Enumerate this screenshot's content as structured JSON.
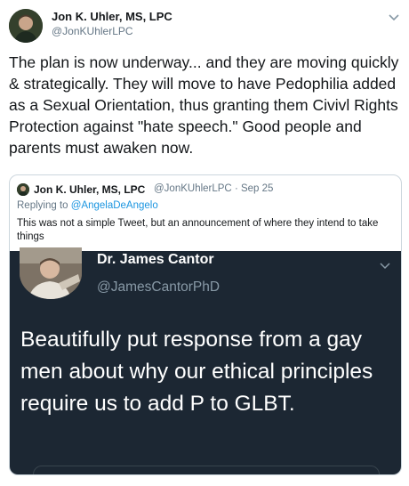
{
  "tweet": {
    "author_name": "Jon K. Uhler, MS, LPC",
    "author_handle": "@JonKUhlerLPC",
    "body": "The plan is now underway... and they are moving quickly & strategically. They will move to have Pedophilia added as a Sexual Orientation, thus granting them Civivl Rights Protection against \"hate speech.\"  Good people and parents must awaken now."
  },
  "quoted_tweet": {
    "author_name": "Jon K. Uhler, MS, LPC",
    "author_handle": "@JonKUhlerLPC",
    "date": "Sep 25",
    "reply_prefix": "Replying to ",
    "reply_to": "@AngelaDeAngelo",
    "body": "This was not a simple Tweet, but an announcement of where they intend to take things"
  },
  "embedded_screenshot": {
    "author_name": "Dr. James Cantor",
    "author_handle": "@JamesCantorPhD",
    "body": "Beautifully put response from a gay men about why our ethical principles require us to add P to GLBT."
  },
  "icons": {
    "menu": "chevron-down-icon"
  },
  "colors": {
    "link": "#1b95e0",
    "secondary_text": "#657786",
    "dark_background": "#1c2733"
  }
}
